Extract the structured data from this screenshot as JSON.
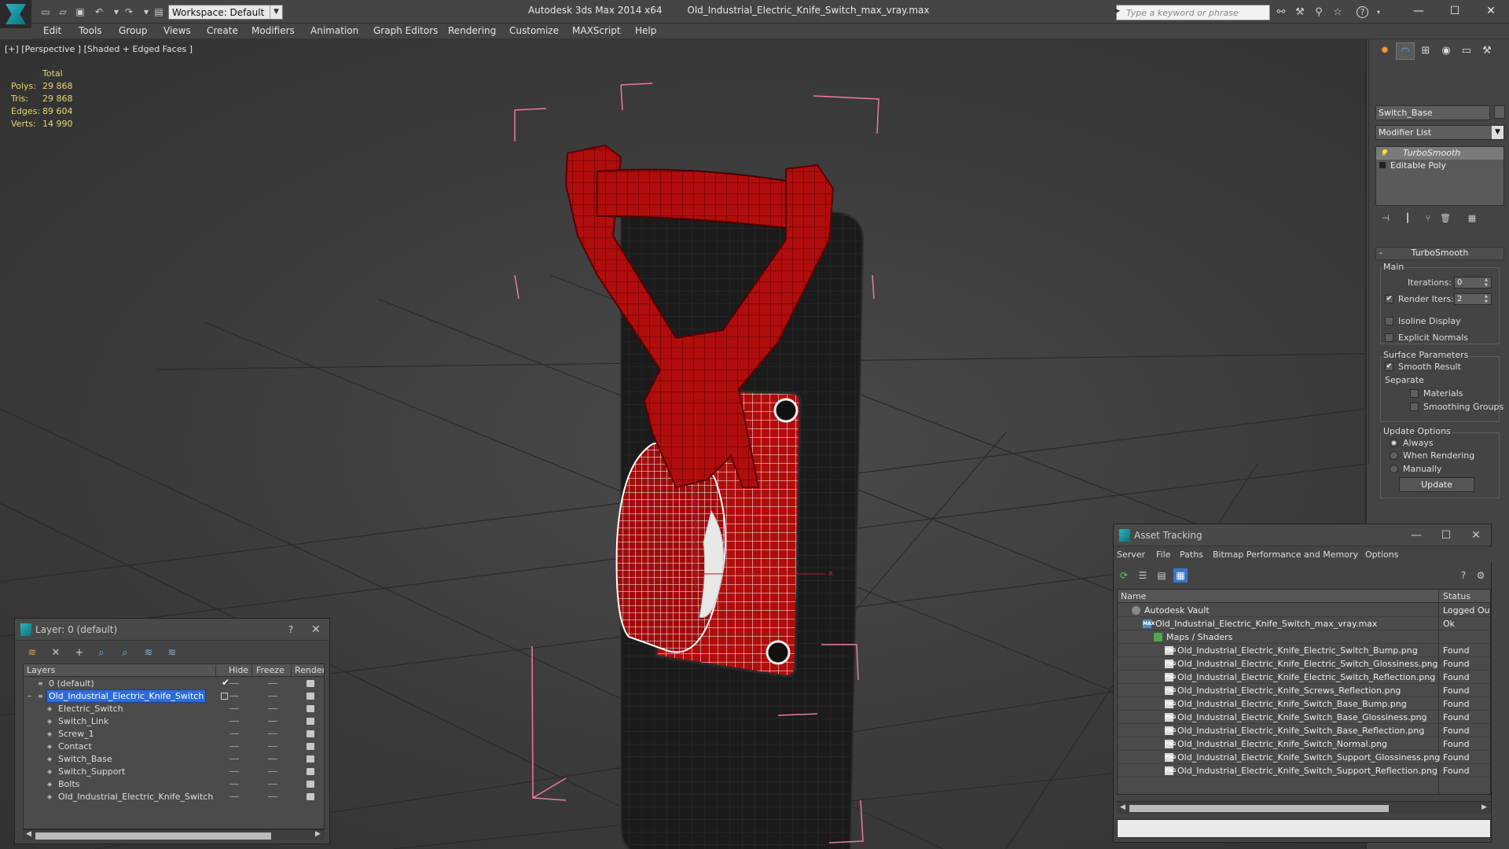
{
  "app": {
    "title": "Autodesk 3ds Max  2014 x64",
    "file": "Old_Industrial_Electric_Knife_Switch_max_vray.max",
    "workspace": "Workspace: Default",
    "search_placeholder": "Type a keyword or phrase",
    "win_minimize": "—",
    "win_maximize": "☐",
    "win_close": "✕"
  },
  "menu": [
    "Edit",
    "Tools",
    "Group",
    "Views",
    "Create",
    "Modifiers",
    "Animation",
    "Graph Editors",
    "Rendering",
    "Customize",
    "MAXScript",
    "Help"
  ],
  "viewport": {
    "label": "[+] [Perspective ] [Shaded + Edged Faces ]",
    "stats_header": "Total",
    "stats": [
      {
        "label": "Polys:",
        "value": "29 868"
      },
      {
        "label": "Tris:",
        "value": "29 868"
      },
      {
        "label": "Edges:",
        "value": "89 604"
      },
      {
        "label": "Verts:",
        "value": "14 990"
      }
    ]
  },
  "command_panel": {
    "object_name": "Switch_Base",
    "modifier_list": "Modifier List",
    "stack": [
      {
        "label": "TurboSmooth",
        "selected": true
      },
      {
        "label": "Editable Poly",
        "selected": false
      }
    ],
    "rollout_title": "TurboSmooth",
    "rollout_collapse": "-",
    "main_label": "Main",
    "iterations_label": "Iterations:",
    "iterations_value": "0",
    "render_iters_label": "Render Iters:",
    "render_iters_value": "2",
    "isoline_label": "Isoline Display",
    "explicit_normals_label": "Explicit Normals",
    "surface_params_label": "Surface Parameters",
    "smooth_result_label": "Smooth Result",
    "separate_label": "Separate",
    "materials_label": "Materials",
    "smoothing_groups_label": "Smoothing Groups",
    "update_options_label": "Update Options",
    "always_label": "Always",
    "when_rendering_label": "When Rendering",
    "manually_label": "Manually",
    "update_button": "Update"
  },
  "layer_dialog": {
    "title": "Layer: 0 (default)",
    "help": "?",
    "close": "✕",
    "columns": [
      "Layers",
      "Hide",
      "Freeze",
      "Render"
    ],
    "rows": [
      {
        "name": "0 (default)",
        "level": 0,
        "selected": false,
        "current": true
      },
      {
        "name": "Old_Industrial_Electric_Knife_Switch",
        "level": 0,
        "selected": true,
        "current": false
      },
      {
        "name": "Electric_Switch",
        "level": 1,
        "selected": false,
        "current": false
      },
      {
        "name": "Switch_Link",
        "level": 1,
        "selected": false,
        "current": false
      },
      {
        "name": "Screw_1",
        "level": 1,
        "selected": false,
        "current": false
      },
      {
        "name": "Contact",
        "level": 1,
        "selected": false,
        "current": false
      },
      {
        "name": "Switch_Base",
        "level": 1,
        "selected": false,
        "current": false
      },
      {
        "name": "Switch_Support",
        "level": 1,
        "selected": false,
        "current": false
      },
      {
        "name": "Bolts",
        "level": 1,
        "selected": false,
        "current": false
      },
      {
        "name": "Old_Industrial_Electric_Knife_Switch",
        "level": 1,
        "selected": false,
        "current": false
      }
    ]
  },
  "asset_dialog": {
    "title": "Asset Tracking",
    "minimize": "—",
    "maximize": "☐",
    "close": "✕",
    "menu": [
      "Server",
      "File",
      "Paths",
      "Bitmap Performance and Memory",
      "Options"
    ],
    "columns": [
      "Name",
      "Status"
    ],
    "rows": [
      {
        "name": "Autodesk Vault",
        "status": "Logged Out",
        "level": 0,
        "icon": "vault"
      },
      {
        "name": "Old_Industrial_Electric_Knife_Switch_max_vray.max",
        "status": "Ok",
        "level": 1,
        "icon": "max"
      },
      {
        "name": "Maps / Shaders",
        "status": "",
        "level": 2,
        "icon": "maps"
      },
      {
        "name": "Old_Industrial_Electric_Knife_Electric_Switch_Bump.png",
        "status": "Found",
        "level": 3,
        "icon": "png"
      },
      {
        "name": "Old_Industrial_Electric_Knife_Electric_Switch_Glossiness.png",
        "status": "Found",
        "level": 3,
        "icon": "png"
      },
      {
        "name": "Old_Industrial_Electric_Knife_Electric_Switch_Reflection.png",
        "status": "Found",
        "level": 3,
        "icon": "png"
      },
      {
        "name": "Old_Industrial_Electric_Knife_Screws_Reflection.png",
        "status": "Found",
        "level": 3,
        "icon": "png"
      },
      {
        "name": "Old_Industrial_Electric_Knife_Switch_Base_Bump.png",
        "status": "Found",
        "level": 3,
        "icon": "png"
      },
      {
        "name": "Old_Industrial_Electric_Knife_Switch_Base_Glossiness.png",
        "status": "Found",
        "level": 3,
        "icon": "png"
      },
      {
        "name": "Old_Industrial_Electric_Knife_Switch_Base_Reflection.png",
        "status": "Found",
        "level": 3,
        "icon": "png"
      },
      {
        "name": "Old_Industrial_Electric_Knife_Switch_Normal.png",
        "status": "Found",
        "level": 3,
        "icon": "png"
      },
      {
        "name": "Old_Industrial_Electric_Knife_Switch_Support_Glossiness.png",
        "status": "Found",
        "level": 3,
        "icon": "png"
      },
      {
        "name": "Old_Industrial_Electric_Knife_Switch_Support_Reflection.png",
        "status": "Found",
        "level": 3,
        "icon": "png"
      }
    ]
  },
  "colors": {
    "model_red": "#b00d0d",
    "model_base": "#1e1e1e",
    "selection_box": "#f07a9a",
    "stats_text": "#e6d870",
    "highlight": "#2e6bd6"
  }
}
